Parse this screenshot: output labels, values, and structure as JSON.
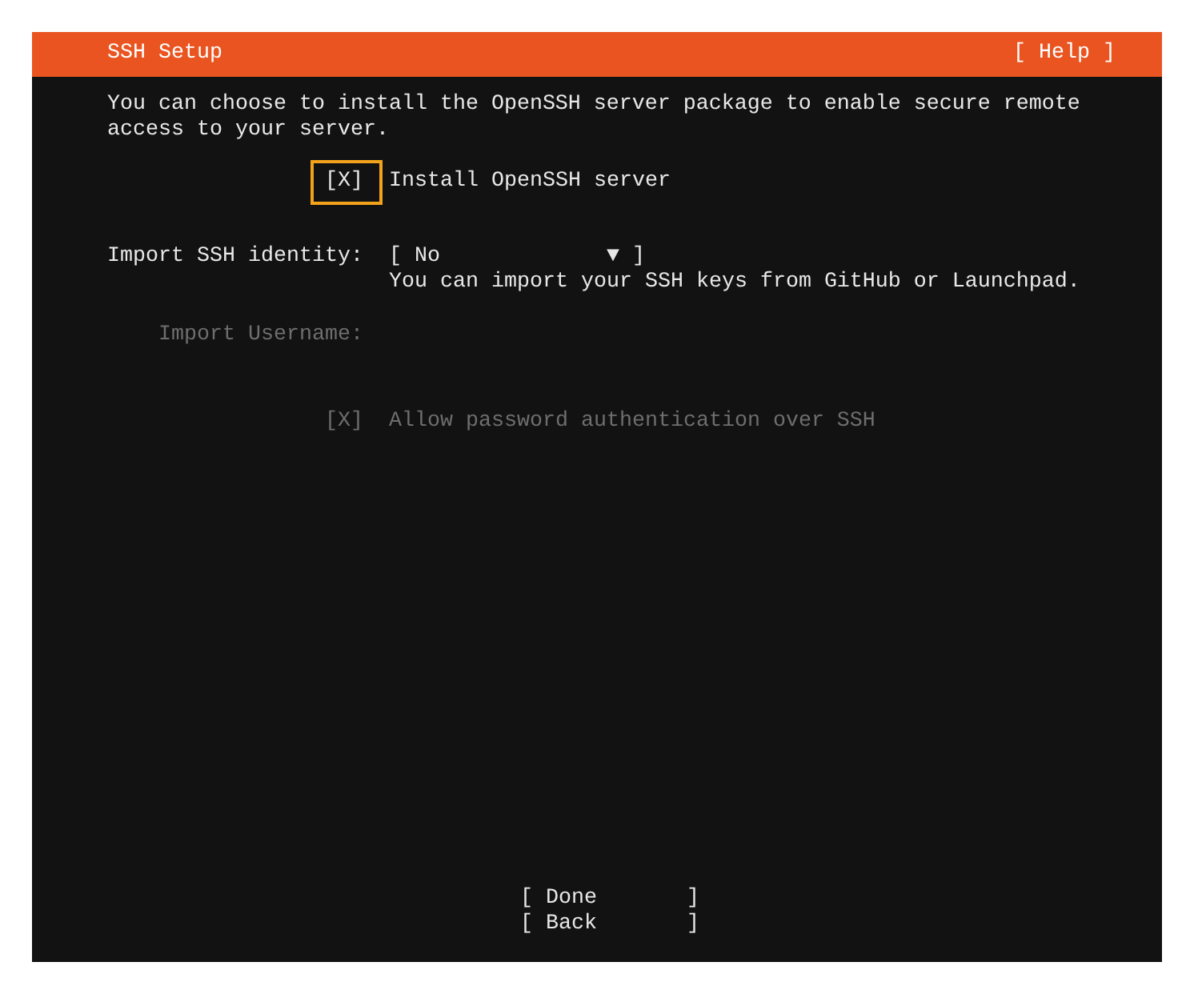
{
  "header": {
    "title": "SSH Setup",
    "help": "[ Help ]"
  },
  "description": "You can choose to install the OpenSSH server package to enable secure remote access to your server.",
  "form": [
    {
      "kind": "checkbox",
      "box": "[X]",
      "label": "Install OpenSSH server",
      "focused": true,
      "disabled": false
    },
    {
      "kind": "select",
      "label": "Import SSH identity:",
      "open": "[",
      "value": "No",
      "arrow": "▼",
      "close": "]",
      "hint": "You can import your SSH keys from GitHub or Launchpad.",
      "disabled": false
    },
    {
      "kind": "input",
      "label": "Import Username:",
      "disabled": true
    },
    {
      "kind": "checkbox",
      "box": "[X]",
      "label": "Allow password authentication over SSH",
      "focused": false,
      "disabled": true
    }
  ],
  "buttons": [
    {
      "open": "[",
      "label": "Done",
      "close": "]"
    },
    {
      "open": "[",
      "label": "Back",
      "close": "]"
    }
  ]
}
